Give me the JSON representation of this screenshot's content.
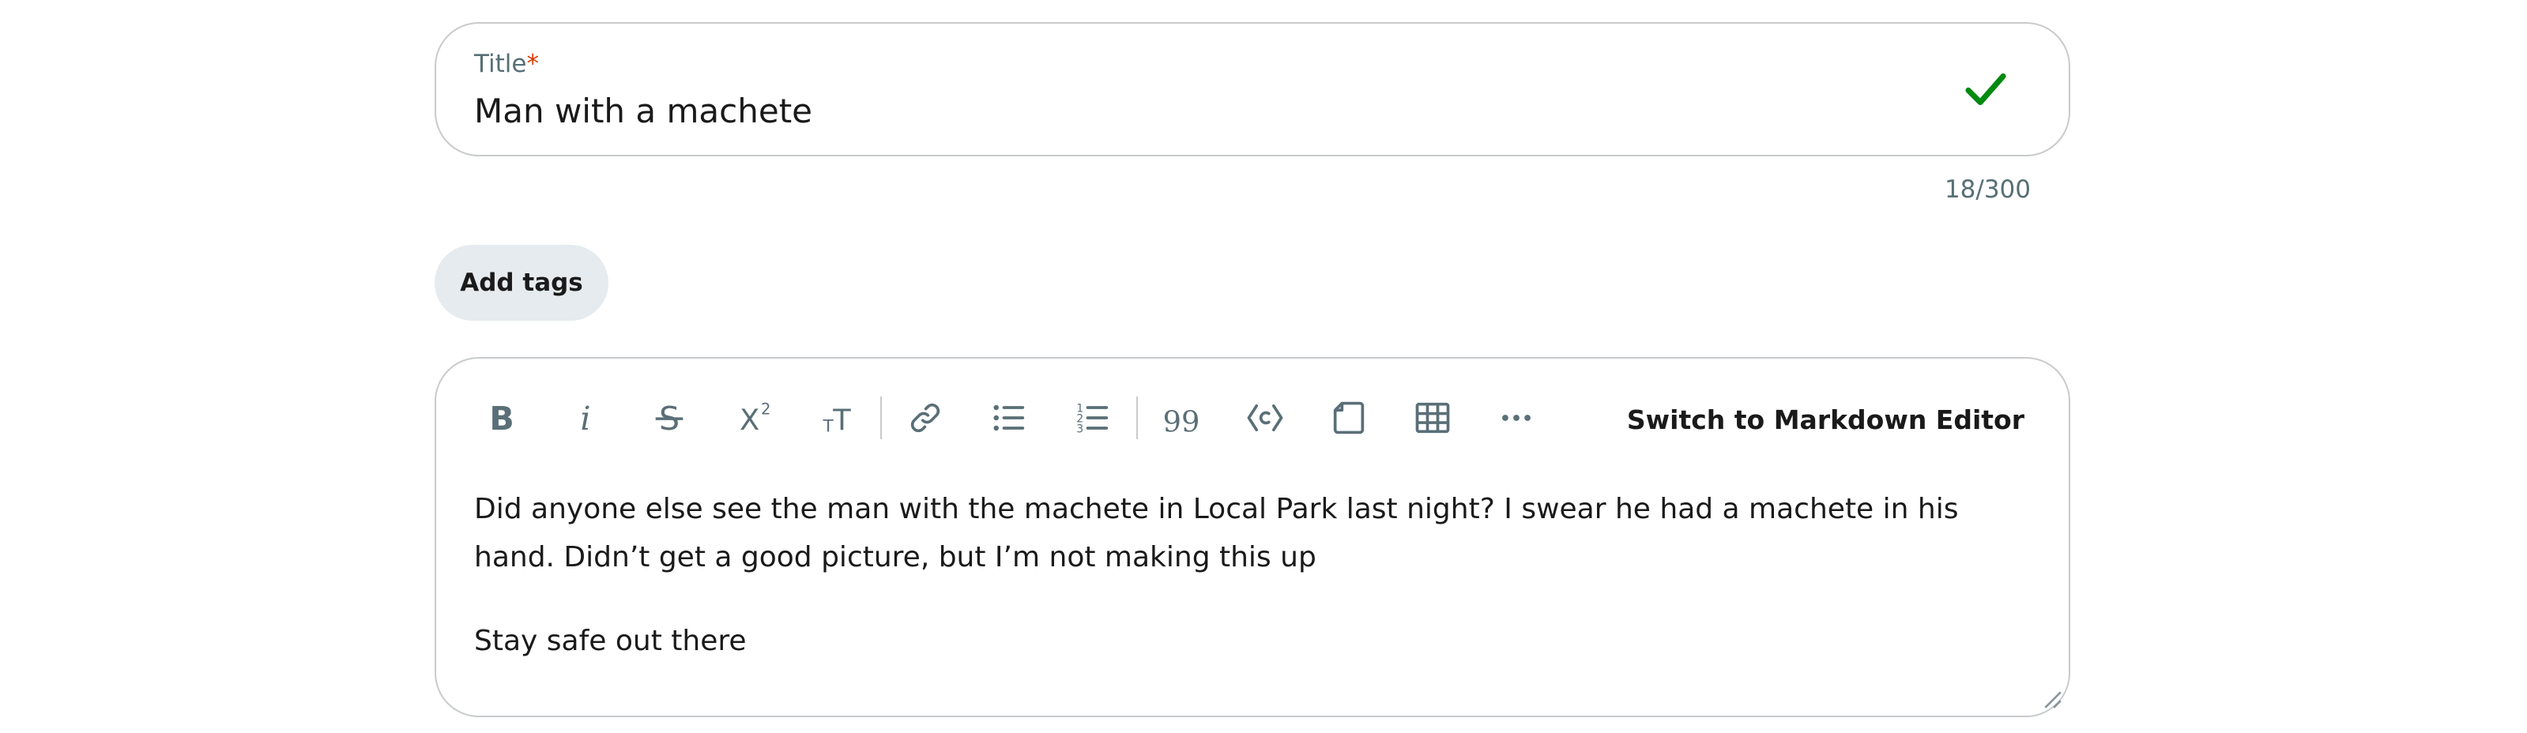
{
  "title_field": {
    "label": "Title",
    "required_mark": "*",
    "value": "Man with a machete",
    "char_count": "18/300",
    "valid_icon": "checkmark-icon",
    "valid_color": "#008a10"
  },
  "tags": {
    "button_label": "Add tags"
  },
  "editor": {
    "toolbar": [
      {
        "name": "bold-button",
        "icon": "bold-icon"
      },
      {
        "name": "italic-button",
        "icon": "italic-icon"
      },
      {
        "name": "strikethrough-button",
        "icon": "strikethrough-icon"
      },
      {
        "name": "superscript-button",
        "icon": "superscript-icon"
      },
      {
        "name": "heading-button",
        "icon": "text-size-icon"
      },
      {
        "name": "link-button",
        "icon": "link-icon"
      },
      {
        "name": "bulleted-list-button",
        "icon": "bulleted-list-icon"
      },
      {
        "name": "numbered-list-button",
        "icon": "numbered-list-icon"
      },
      {
        "name": "quote-button",
        "icon": "quote-icon"
      },
      {
        "name": "code-button",
        "icon": "code-icon"
      },
      {
        "name": "code-block-button",
        "icon": "code-block-icon"
      },
      {
        "name": "table-button",
        "icon": "table-icon"
      },
      {
        "name": "more-button",
        "icon": "more-icon"
      }
    ],
    "switch_label": "Switch to Markdown Editor",
    "paragraphs": [
      "Did anyone else see the man with the machete in Local Park last night? I swear he had a machete in his hand. Didn’t get a good picture, but I’m not making this up",
      "Stay safe out there"
    ]
  },
  "colors": {
    "border": "#c8cbcd",
    "tag_button_bg": "#e5ebee",
    "icon": "#5a6f77",
    "required": "#d93a00"
  }
}
